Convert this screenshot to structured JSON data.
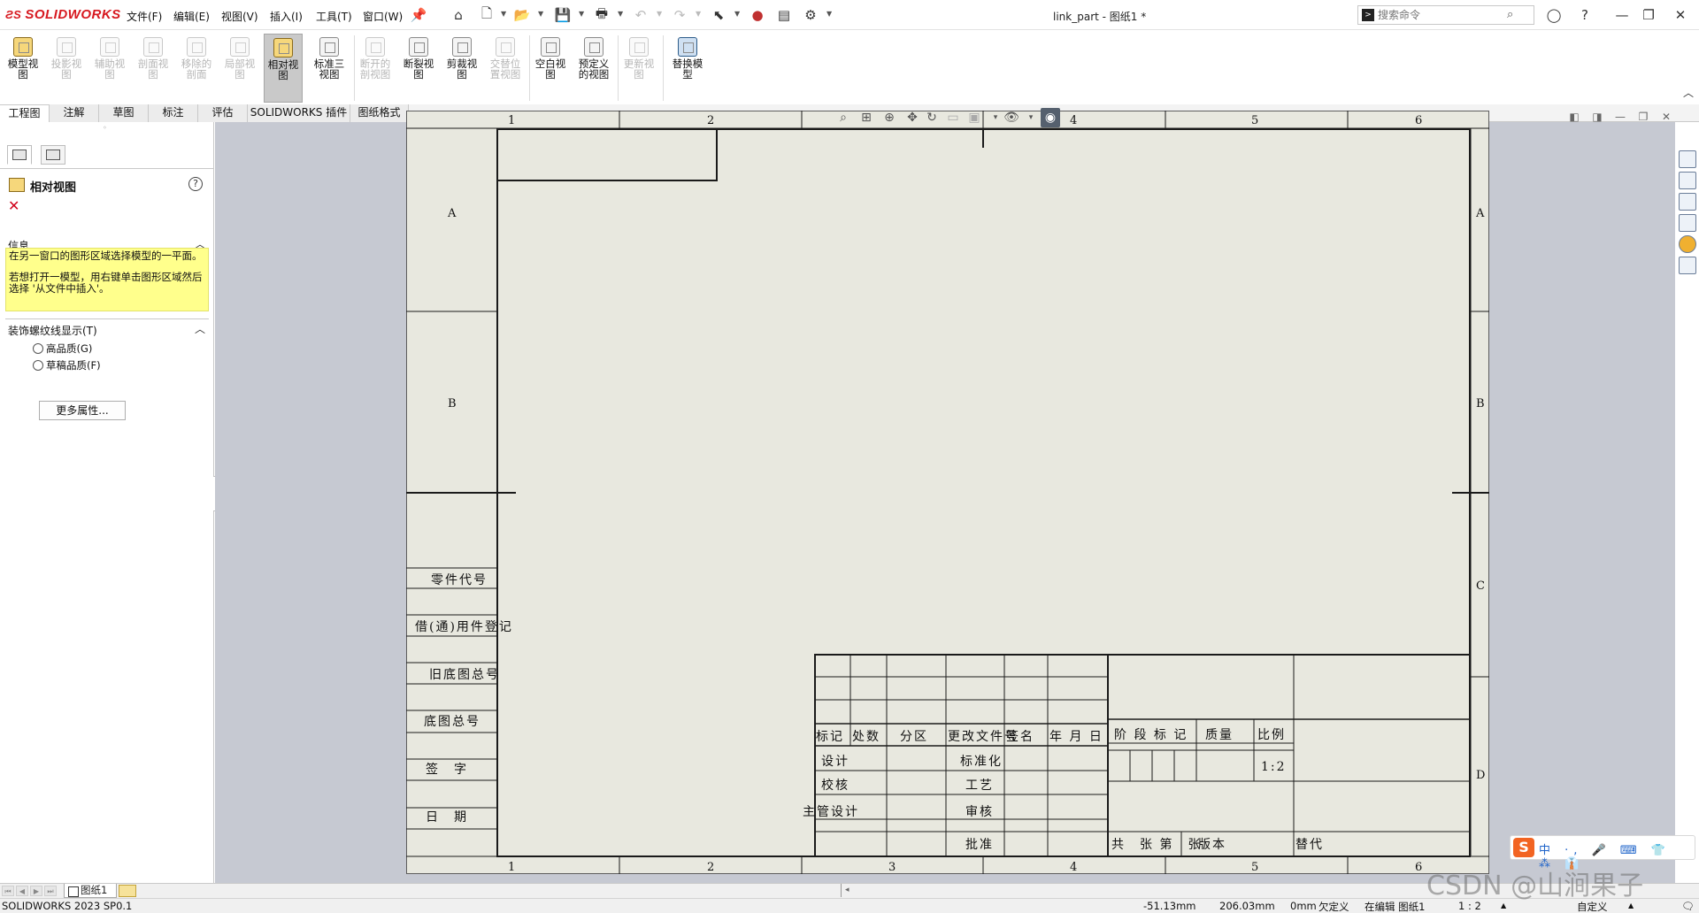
{
  "app": {
    "logo": "SOLIDWORKS",
    "doc_title": "link_part - 图纸1 *"
  },
  "menu": [
    "文件(F)",
    "编辑(E)",
    "视图(V)",
    "插入(I)",
    "工具(T)",
    "窗口(W)"
  ],
  "search": {
    "placeholder": "搜索命令"
  },
  "ribbon": {
    "buttons": [
      {
        "label": "模型视图",
        "state": "enabled"
      },
      {
        "label": "投影视图",
        "state": "disabled"
      },
      {
        "label": "辅助视图",
        "state": "disabled"
      },
      {
        "label": "剖面视图",
        "state": "disabled"
      },
      {
        "label": "移除的剖面",
        "state": "disabled"
      },
      {
        "label": "局部视图",
        "state": "disabled"
      },
      {
        "label": "相对视图",
        "state": "active"
      },
      {
        "label": "标准三视图",
        "state": "enabled"
      },
      {
        "label": "断开的剖视图",
        "state": "disabled"
      },
      {
        "label": "断裂视图",
        "state": "enabled"
      },
      {
        "label": "剪裁视图",
        "state": "enabled"
      },
      {
        "label": "交替位置视图",
        "state": "disabled"
      },
      {
        "label": "空白视图",
        "state": "enabled"
      },
      {
        "label": "预定义的视图",
        "state": "enabled"
      },
      {
        "label": "更新视图",
        "state": "disabled"
      },
      {
        "label": "替换模型",
        "state": "enabled"
      }
    ]
  },
  "command_tabs": [
    "工程图",
    "注解",
    "草图",
    "标注",
    "评估",
    "SOLIDWORKS 插件",
    "图纸格式"
  ],
  "property_manager": {
    "title": "相对视图",
    "info_header": "信息",
    "info_line1": "在另一窗口的图形区域选择模型的一平面。",
    "info_line2": "若想打开一模型，用右键单击图形区域然后选择 '从文件中插入'。",
    "cosmetic_header": "装饰螺纹线显示(T)",
    "option_high": "高品质(G)",
    "option_draft": "草稿品质(F)",
    "more_props": "更多属性..."
  },
  "sheet": {
    "col_labels": [
      "1",
      "2",
      "3",
      "4",
      "5",
      "6"
    ],
    "row_labels": [
      "A",
      "B",
      "C",
      "D"
    ],
    "left_strip": [
      "零件代号",
      "借(通)用件登记",
      "旧底图总号",
      "底图总号",
      "签　字",
      "日　期"
    ],
    "title_block": {
      "headers": [
        "标记",
        "处数",
        "分区",
        "更改文件号",
        "签名",
        "年 月 日"
      ],
      "roles": [
        "设计",
        "校核",
        "主管设计"
      ],
      "right_roles": [
        "标准化",
        "工艺",
        "审核",
        "批准"
      ],
      "stage": "阶 段 标 记",
      "mass": "质量",
      "scale_label": "比例",
      "scale_value": "1:2",
      "sheets": "共　张 第　张",
      "version": "版本",
      "replace": "替代"
    }
  },
  "sheet_tabs": {
    "active": "图纸1"
  },
  "status": {
    "version": "SOLIDWORKS 2023 SP0.1",
    "x": "-51.13mm",
    "y": "206.03mm",
    "z": "0mm",
    "defined": "欠定义",
    "editing": "在编辑 图纸1",
    "scale": "1 : 2",
    "custom": "自定义"
  },
  "watermark": "CSDN @山涧果子",
  "ime": {
    "items": "中 ·, 🎤 ⌨ 👕 ⁂ 👔"
  }
}
